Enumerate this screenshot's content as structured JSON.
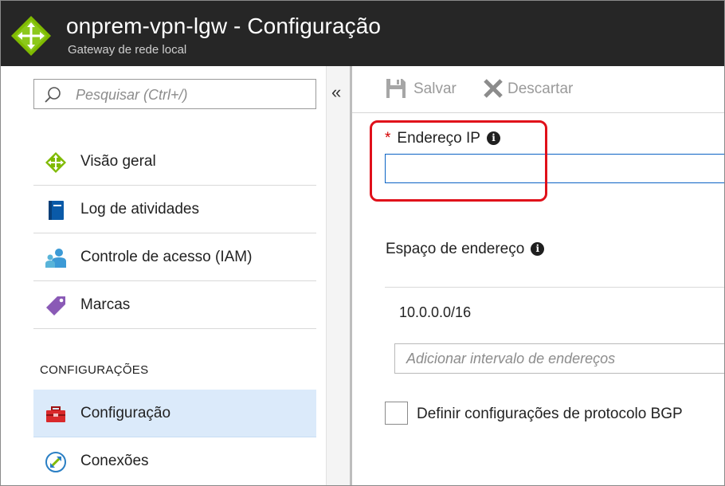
{
  "header": {
    "title": "onprem-vpn-lgw - Configuração",
    "subtitle": "Gateway de rede local",
    "logo_icon": "local-network-gateway-icon",
    "background": "#262626"
  },
  "sidebar": {
    "search_placeholder": "Pesquisar (Ctrl+/)",
    "collapse_glyph": "«",
    "items": [
      {
        "label": "Visão geral",
        "icon": "overview-gateway-icon"
      },
      {
        "label": "Log de atividades",
        "icon": "activity-log-icon"
      },
      {
        "label": "Controle de acesso (IAM)",
        "icon": "access-control-icon"
      },
      {
        "label": "Marcas",
        "icon": "tag-icon"
      }
    ],
    "section_title": "CONFIGURAÇÕES",
    "settings_items": [
      {
        "label": "Configuração",
        "icon": "toolbox-icon",
        "active": true
      },
      {
        "label": "Conexões",
        "icon": "connections-icon",
        "active": false
      }
    ],
    "active_color": "#dbeafa"
  },
  "toolbar": {
    "save_label": "Salvar",
    "discard_label": "Descartar"
  },
  "form": {
    "ip_required_mark": "*",
    "ip_label": "Endereço IP",
    "ip_value": "",
    "address_space_label": "Espaço de endereço",
    "address_space_values": [
      "10.0.0.0/16"
    ],
    "add_range_placeholder": "Adicionar intervalo de endereços",
    "bgp_checkbox_label": "Definir configurações de protocolo BGP",
    "bgp_checked": false,
    "highlight_color": "#e0101a"
  }
}
